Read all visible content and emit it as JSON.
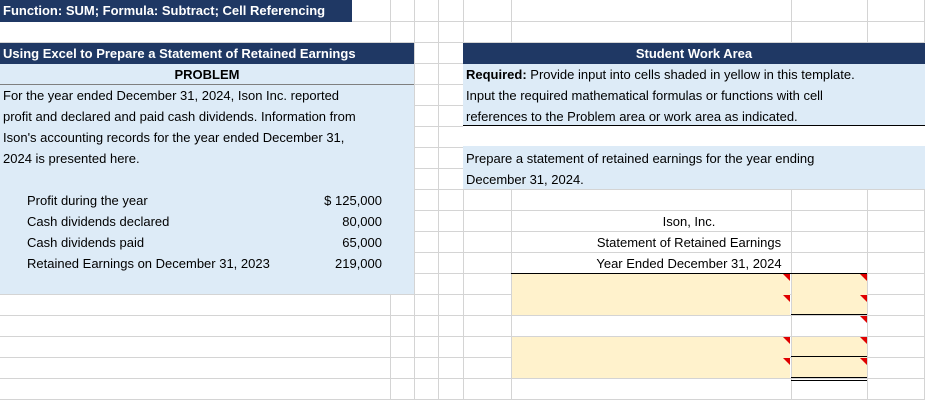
{
  "title_bar": "Function: SUM; Formula: Subtract; Cell Referencing",
  "left": {
    "header": "Using Excel to Prepare a Statement of Retained Earnings",
    "problem_label": "PROBLEM",
    "description_lines": [
      "For the year ended December 31, 2024, Ison Inc. reported",
      "profit and declared and paid cash dividends. Information from",
      "Ison's accounting records for the year ended December 31,",
      "2024 is presented here."
    ],
    "items": [
      {
        "label": "Profit during the year",
        "value": "$ 125,000"
      },
      {
        "label": "Cash dividends declared",
        "value": "80,000"
      },
      {
        "label": "Cash dividends paid",
        "value": "65,000"
      },
      {
        "label": "Retained Earnings on December 31, 2023",
        "value": "219,000"
      }
    ]
  },
  "right": {
    "header": "Student Work Area",
    "required_bold": "Required:",
    "required_line1": " Provide input into cells shaded in yellow in this template.",
    "required_line2": "Input the required mathematical formulas or functions with cell",
    "required_line3": "references to the Problem area or work area as indicated.",
    "prepare_line1": "Prepare a statement of retained earnings for the year ending",
    "prepare_line2": "December 31, 2024.",
    "company": "Ison, Inc.",
    "statement_title": "Statement of Retained Earnings",
    "period": "Year Ended December 31, 2024"
  },
  "colors": {
    "navy": "#1f3864",
    "light_blue": "#ddebf7",
    "input_yellow": "#fff2cc",
    "comment_marker": "#e00000"
  }
}
